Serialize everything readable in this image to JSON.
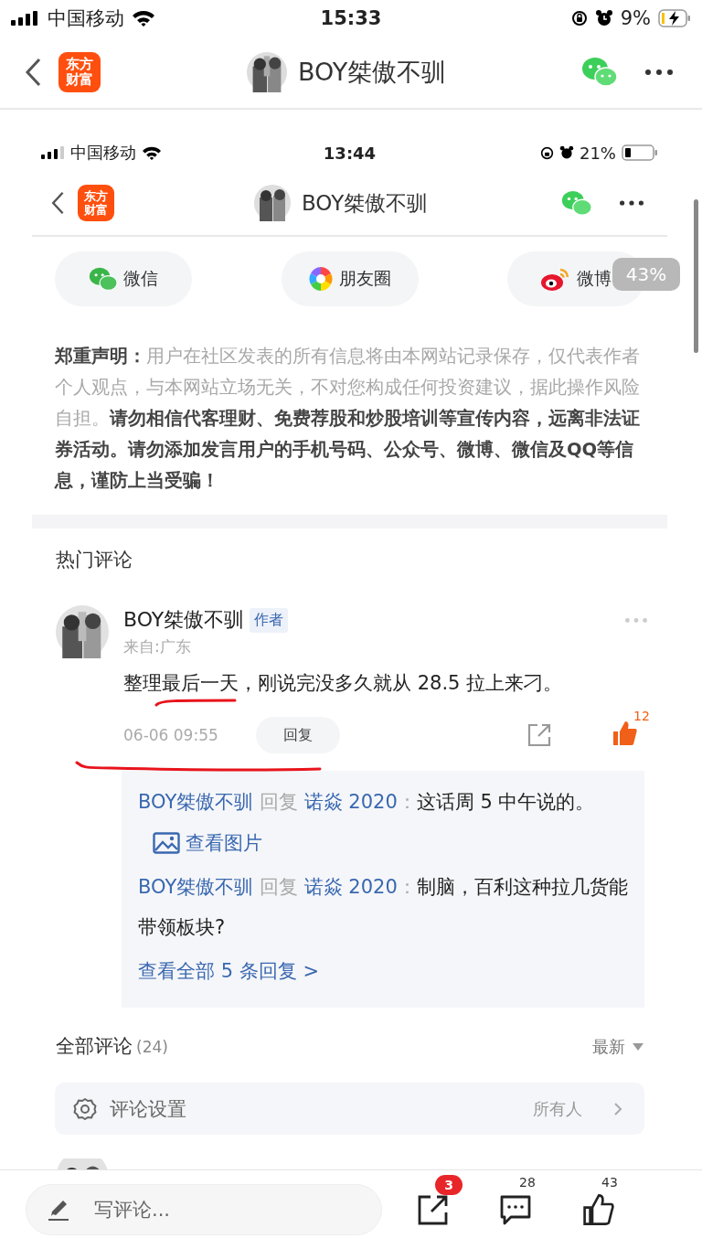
{
  "status_bar": {
    "carrier": "中国移动",
    "time": "15:33",
    "battery": "9%"
  },
  "header": {
    "app_logo": [
      "东方",
      "财富"
    ],
    "title": "BOY桀傲不驯"
  },
  "screenshot": {
    "status_bar": {
      "carrier": "中国移动",
      "time": "13:44",
      "battery": "21%"
    },
    "header": {
      "app_logo": [
        "东方",
        "财富"
      ],
      "title": "BOY桀傲不驯"
    },
    "share_options": [
      {
        "kind": "wechat",
        "label": "微信"
      },
      {
        "kind": "moments",
        "label": "朋友圈"
      },
      {
        "kind": "weibo",
        "label": "微博"
      }
    ],
    "disclaimer": "**郑重声明：**用户在社区发表的所有信息将由本网站记录保存，仅代表作者个人观点，与本网站立场无关，不对您构成任何投资建议，据此操作风险自担。**请勿相信代客理财、免费荐股和炒股培训等宣传内容，远离非法证券活动。请勿添加发言用户的手机号码、公众号、微博、微信及QQ等信息，谨防上当受骗！**",
    "hot_comments": {
      "title": "热门评论",
      "comments": [
        {
          "author": "BOY桀傲不驯",
          "badge": "作者",
          "location": "来自:广东",
          "text": "整理最后一天，刚说完没多久就从 28.5 拉上来刁。",
          "time": "06-06 09:55",
          "reply_button": "回复",
          "likes": "12",
          "liked": true,
          "replies": [
            {
              "author": "BOY桀傲不驯",
              "verb": "回复",
              "target": "诺焱 2020",
              "separator": "：",
              "text": "这话周 5 中午说的。",
              "image_link": "查看图片"
            },
            {
              "author": "BOY桀傲不驯",
              "verb": "回复",
              "target": "诺焱 2020",
              "separator": "：",
              "text": "制脑，百利这种拉几货能带领板块?"
            }
          ],
          "view_all": "查看全部 5 条回复 >"
        }
      ]
    },
    "all_comments": {
      "title": "全部评论",
      "count": "(24)",
      "sort": "最新",
      "settings": {
        "label": "评论设置",
        "value": "所有人"
      }
    }
  },
  "scroll_badge": "43%",
  "bottom_bar": {
    "placeholder": "写评论...",
    "share_badge": "3",
    "comments": "28",
    "likes": "43",
    "liked": false
  }
}
